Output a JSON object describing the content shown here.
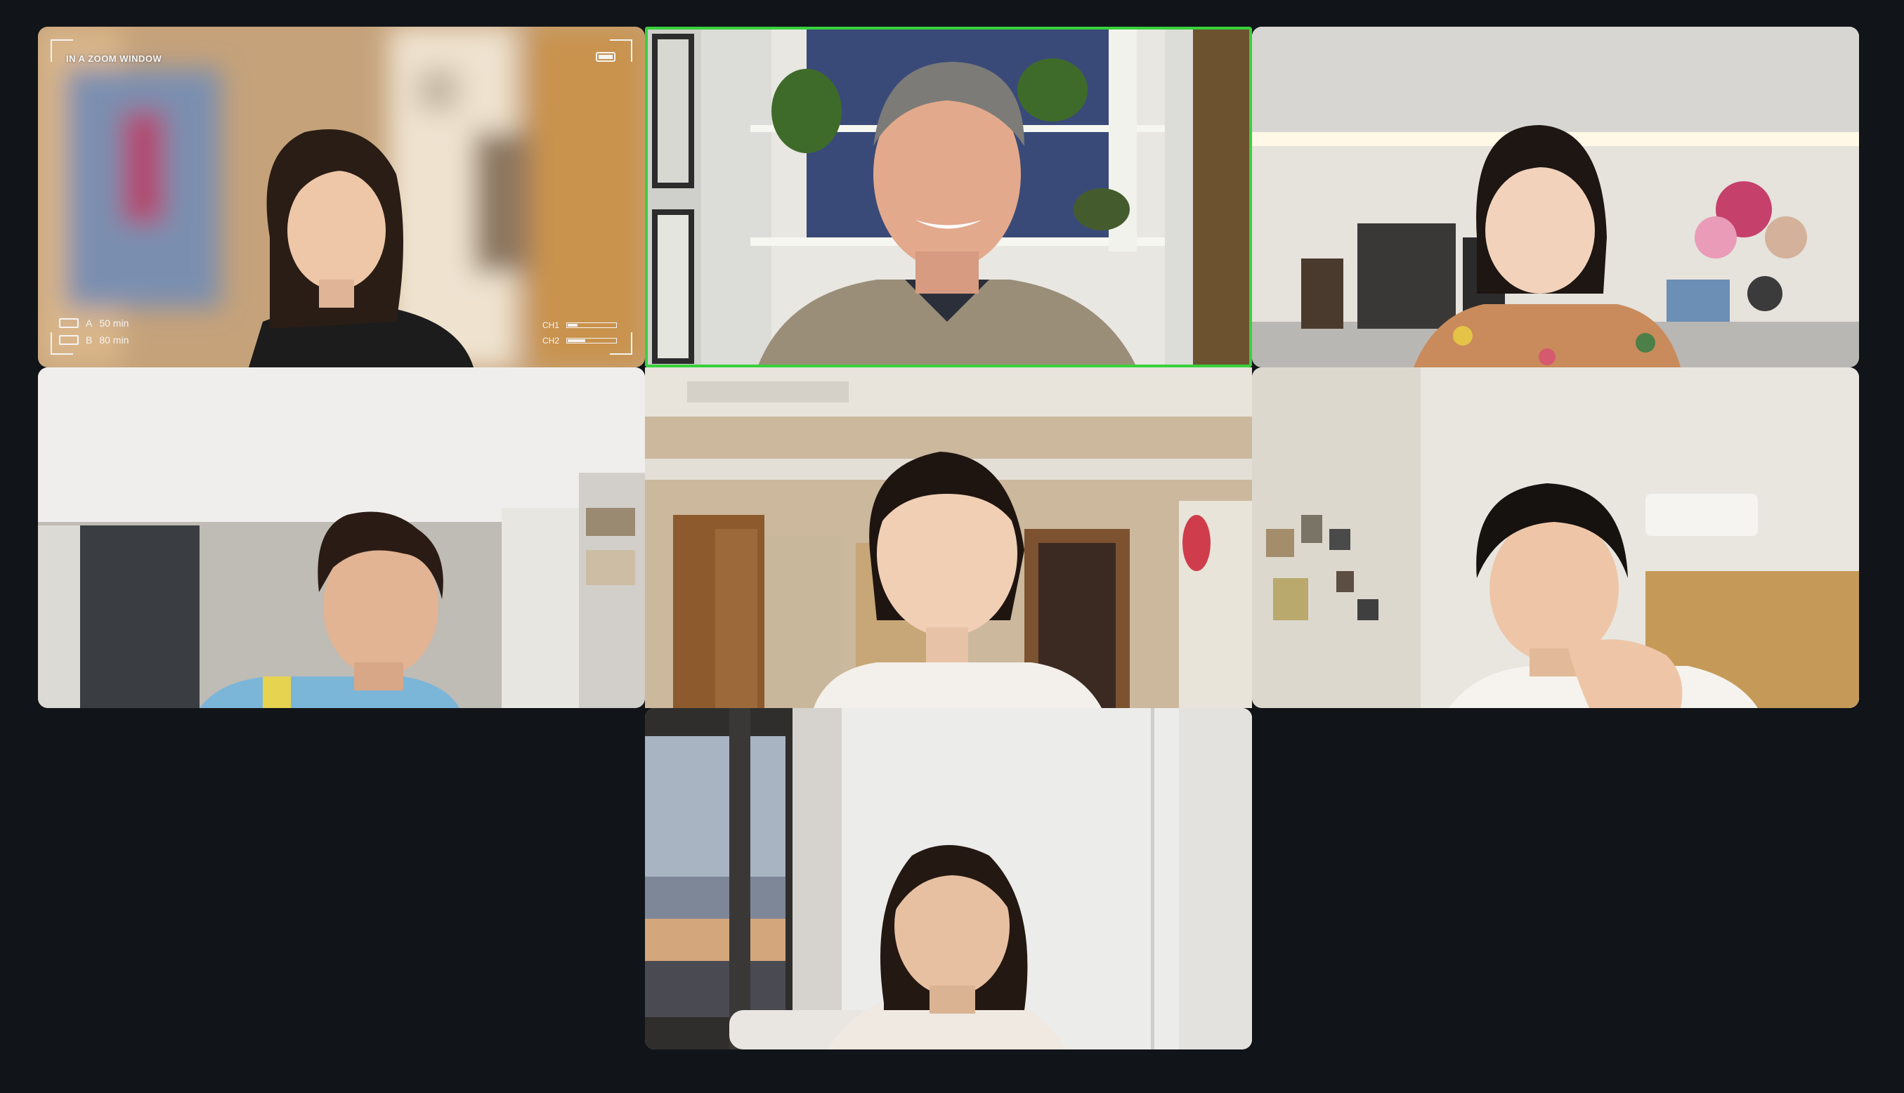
{
  "meeting": {
    "view": "gallery",
    "active_speaker_color": "#38d13b"
  },
  "participants": [
    {
      "id": "p1",
      "virtual_background": {
        "title": "IN A ZOOM WINDOW",
        "rows": [
          {
            "label": "A",
            "value": "50 min"
          },
          {
            "label": "B",
            "value": "80 min"
          }
        ],
        "channels": [
          {
            "label": "CH1",
            "level": 0.2
          },
          {
            "label": "CH2",
            "level": 0.35
          }
        ]
      }
    },
    {
      "id": "p2",
      "active_speaker": true
    },
    {
      "id": "p3"
    },
    {
      "id": "p4"
    },
    {
      "id": "p5"
    },
    {
      "id": "p6"
    },
    {
      "id": "p7"
    }
  ]
}
